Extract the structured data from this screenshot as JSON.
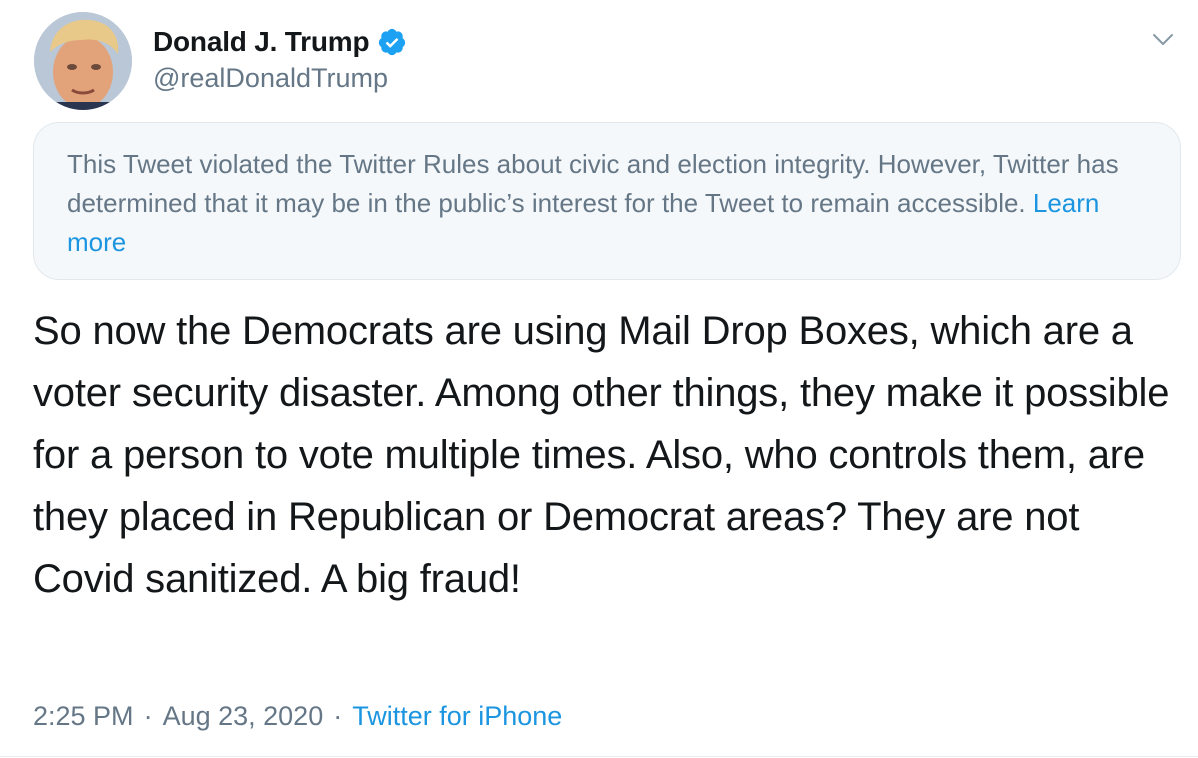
{
  "user": {
    "display_name": "Donald J. Trump",
    "handle": "@realDonaldTrump",
    "verified_icon": "verified-badge-icon",
    "avatar_icon": "avatar"
  },
  "menu": {
    "caret_icon": "chevron-down-icon"
  },
  "notice": {
    "text": "This Tweet violated the Twitter Rules about civic and election integrity. However, Twitter has determined that it may be in the public’s interest for the Tweet to remain accessible.",
    "link_label": "Learn more"
  },
  "tweet": {
    "text": "So now the Democrats are using Mail Drop Boxes, which are a voter security disaster. Among other things, they make it possible for a person to vote multiple times. Also, who controls them, are they placed in Republican or Democrat areas? They are not Covid sanitized. A big fraud!"
  },
  "meta": {
    "time": "2:25 PM",
    "separator": "·",
    "date": "Aug 23, 2020",
    "source": "Twitter for iPhone"
  },
  "colors": {
    "accent": "#1b95e0",
    "secondary_text": "#657786",
    "primary_text": "#14171a",
    "notice_bg": "#f5f8fa"
  }
}
